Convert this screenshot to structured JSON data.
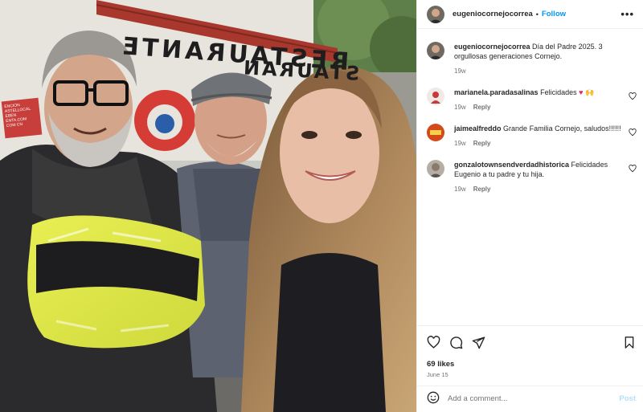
{
  "post": {
    "username": "eugeniocornejocorrea",
    "follow_label": "Follow",
    "separator": "•",
    "more_label": "•••"
  },
  "photo": {
    "sign_main": "RESTAURANTE",
    "sign_sub": "STAURAN",
    "poster_lines": [
      "ENCION",
      "ASTELLOCAL",
      "EBEN ENTA.COM",
      "COM CN"
    ]
  },
  "caption": {
    "username": "eugeniocornejocorrea",
    "text": "Día del Padre 2025. 3 orgullosas generaciones Cornejo.",
    "time": "19w"
  },
  "comments": [
    {
      "username": "marianela.paradasalinas",
      "text": "Felicidades",
      "emoji": "♥ 🙌",
      "time": "19w",
      "reply": "Reply",
      "avatar_color": "#c53b3b"
    },
    {
      "username": "jaimealfreddo",
      "text": "Grande Familia Cornejo, saludos!!!!!!",
      "emoji": "",
      "time": "19w",
      "reply": "Reply",
      "avatar_color": "#d44a1a"
    },
    {
      "username": "gonzalotownsendverdadhistorica",
      "text": "Felicidades Eugenio a tu padre y tu hija.",
      "emoji": "",
      "time": "19w",
      "reply": "Reply",
      "avatar_color": "#8a7a6a"
    }
  ],
  "engagement": {
    "likes": "69 likes",
    "date": "June 15"
  },
  "composer": {
    "placeholder": "Add a comment...",
    "post_label": "Post"
  },
  "icons": {
    "like": "heart-icon",
    "comment": "comment-icon",
    "share": "share-icon",
    "save": "bookmark-icon",
    "emoji": "emoji-icon"
  },
  "colors": {
    "link_blue": "#0095f6",
    "muted": "#737373",
    "post_disabled": "#b2dffc",
    "border": "#efefef"
  }
}
